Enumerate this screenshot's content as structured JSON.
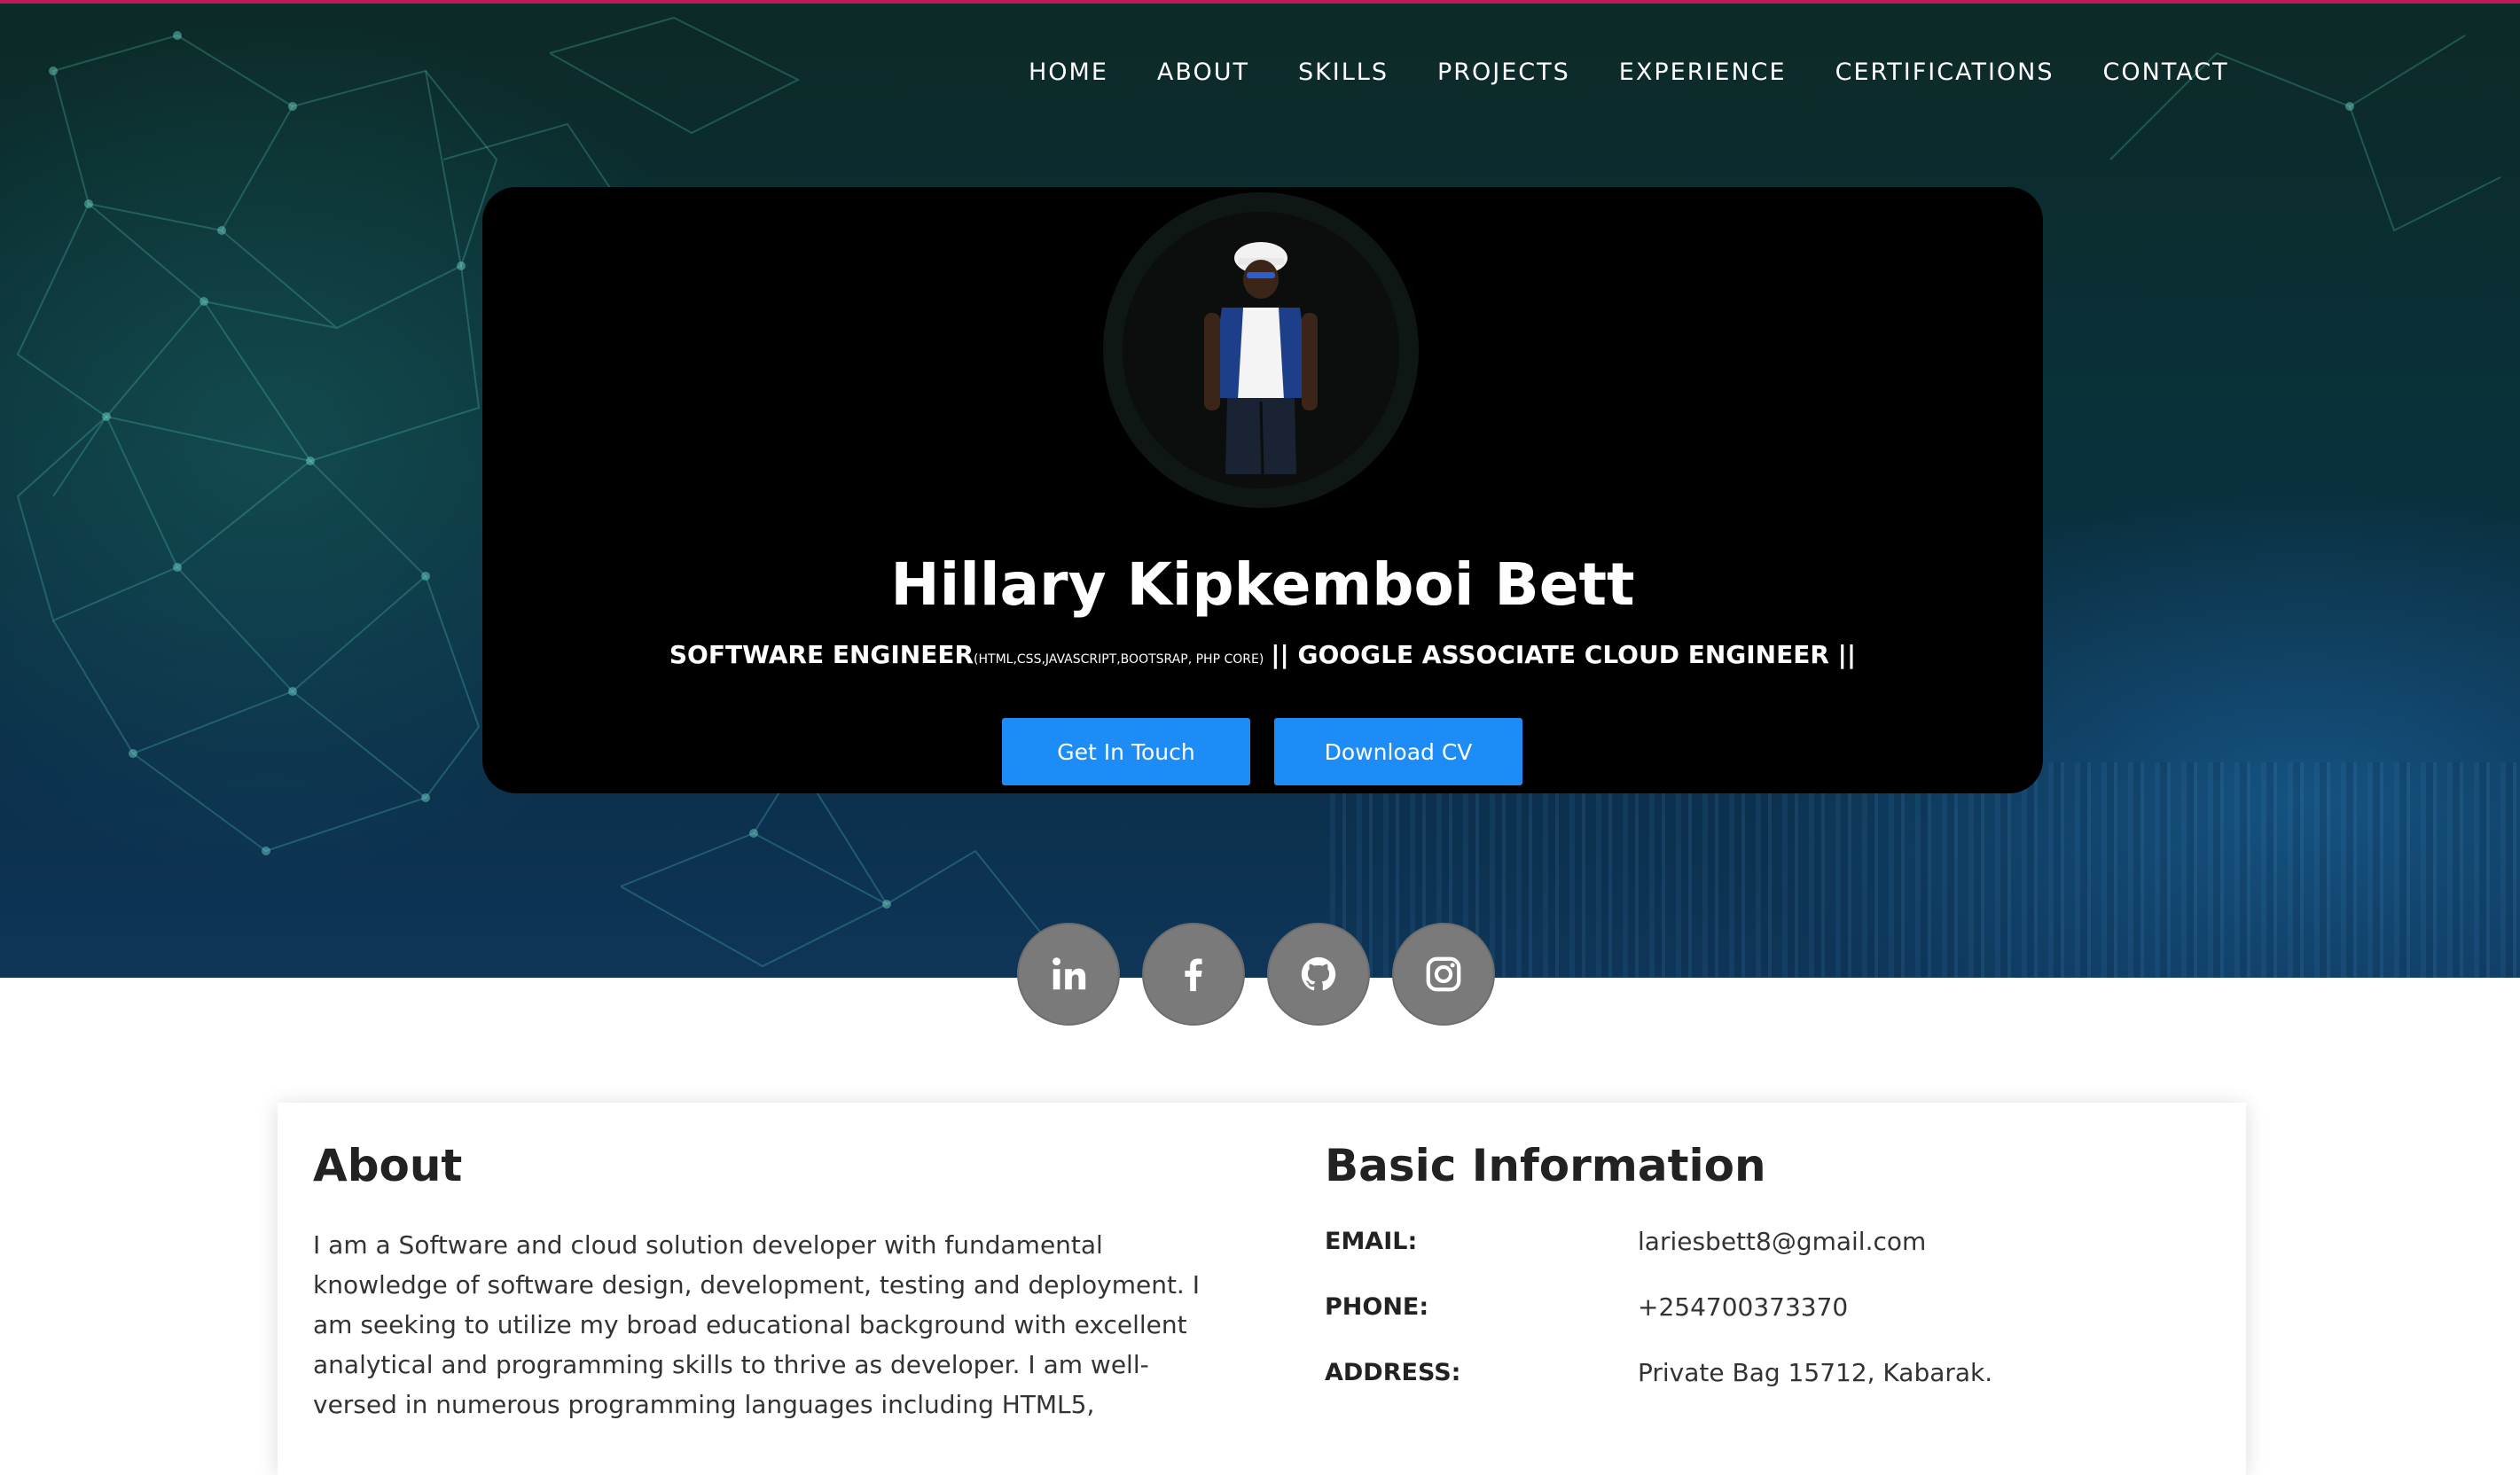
{
  "nav": {
    "items": [
      "HOME",
      "ABOUT",
      "SKILLS",
      "PROJECTS",
      "EXPERIENCE",
      "CERTIFICATIONS",
      "CONTACT"
    ]
  },
  "hero": {
    "name": "Hillary Kipkemboi Bett",
    "title_main": "SOFTWARE ENGINEER",
    "title_stack": "(HTML,CSS,JAVASCRIPT,BOOTSRAP, PHP CORE)",
    "title_rest": "|| GOOGLE ASSOCIATE CLOUD ENGINEER ||",
    "buttons": {
      "touch": "Get In Touch",
      "cv": "Download CV"
    },
    "accent_color": "#1e8cf6",
    "topline_color": "#c2185b"
  },
  "socials": [
    {
      "icon": "linkedin-icon"
    },
    {
      "icon": "facebook-icon"
    },
    {
      "icon": "github-icon"
    },
    {
      "icon": "instagram-icon"
    }
  ],
  "about": {
    "heading": "About",
    "lines": [
      "I am a Software and cloud solution developer with fundamental",
      "knowledge of software design, development, testing and deployment. I",
      "am seeking to utilize my broad educational background with excellent",
      "analytical and programming skills to thrive as developer. I am well-",
      "versed in numerous programming languages including HTML5,"
    ]
  },
  "basic_info": {
    "heading": "Basic Information",
    "rows": [
      {
        "label": "EMAIL:",
        "value": "lariesbett8@gmail.com"
      },
      {
        "label": "PHONE:",
        "value": "+254700373370"
      },
      {
        "label": "ADDRESS:",
        "value": "Private Bag 15712, Kabarak."
      }
    ]
  }
}
